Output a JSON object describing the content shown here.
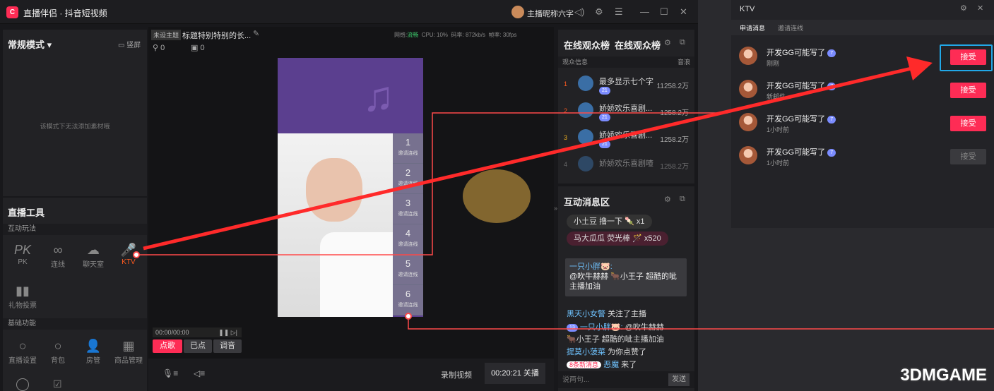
{
  "app": {
    "logo": "C",
    "title": "直播伴侣 · 抖音短视频",
    "streamer": "主播昵称六字"
  },
  "left": {
    "mode": "常规模式",
    "portrait": "竖屏",
    "empty": "该模式下无法添加素材哦",
    "tools_title": "直播工具",
    "sect_interact": "互动玩法",
    "sect_basic": "基础功能",
    "interact": [
      {
        "label": "PK",
        "icon": "PK"
      },
      {
        "label": "连线",
        "icon": "∞"
      },
      {
        "label": "聊天室",
        "icon": "☁"
      },
      {
        "label": "KTV",
        "icon": "🎤"
      }
    ],
    "vote": "礼物投票",
    "basic": [
      {
        "label": "直播设置",
        "icon": "○"
      },
      {
        "label": "背包",
        "icon": "○"
      },
      {
        "label": "房管",
        "icon": "👤"
      },
      {
        "label": "商品管理",
        "icon": "▦"
      }
    ]
  },
  "center": {
    "tag": "未设主题",
    "title": "标题特别特别的长...",
    "viewers": "0",
    "gifts": "0",
    "stats": {
      "net_label": "网络:",
      "net": "流畅",
      "cpu": "CPU: 10%",
      "bitrate": "码率: 872kb/s",
      "fps": "帧率: 30fps"
    },
    "slots": [
      {
        "n": "1",
        "t": "邀请连线"
      },
      {
        "n": "2",
        "t": "邀请连线"
      },
      {
        "n": "3",
        "t": "邀请连线"
      },
      {
        "n": "4",
        "t": "邀请连线"
      },
      {
        "n": "5",
        "t": "邀请连线"
      },
      {
        "n": "6",
        "t": "邀请连线"
      }
    ],
    "time": "00:00/00:00",
    "btn_sing": "点歌",
    "btn_done": "已点",
    "btn_tune": "调音",
    "record": "录制视频",
    "live_time": "00:20:21 关播"
  },
  "ranking": {
    "title1": "在线观众榜",
    "title2": "在线观众榜",
    "col1": "观众信息",
    "col2": "音浪",
    "rows": [
      {
        "rank": "1",
        "name": "最多显示七个字",
        "value": "11258.2万",
        "badge": "21"
      },
      {
        "rank": "2",
        "name": "娇娇欢乐喜剧...",
        "value": "1258.2万",
        "badge": "21"
      },
      {
        "rank": "3",
        "name": "娇娇欢乐喜剧...",
        "value": "1258.2万",
        "badge": "21"
      },
      {
        "rank": "4",
        "name": "娇娇欢乐喜剧喳",
        "value": "1258.2万",
        "badge": ""
      }
    ]
  },
  "chat": {
    "title": "互动消息区",
    "gift1_user": "小土豆",
    "gift1_text": "撸一下",
    "gift1_count": "x1",
    "gift2_user": "马大瓜瓜",
    "gift2_text": "荧光棒",
    "gift2_count": "x520",
    "card_user": "一只小胖🐷:",
    "card_text": "@吹牛赫赫 🐂小王子 超酷的呲主播加油",
    "lines": [
      {
        "user": "黑天小女警",
        "text": "关注了主播"
      },
      {
        "user": "一只小胖🐷:",
        "text": "@吹牛赫赫"
      },
      {
        "user": "",
        "text": "🐂小王子 超酷的呲主播加油"
      },
      {
        "user": "提莫小菠菜",
        "text": "为你点赞了"
      },
      {
        "user": "恶魔",
        "text": "来了"
      }
    ],
    "new_msgs": "8条新消息",
    "input_placeholder": "说两句...",
    "send": "发送"
  },
  "ktv": {
    "title": "KTV",
    "tab1": "申请消息",
    "tab2": "邀请连线",
    "requests": [
      {
        "name": "开发GG可能写了",
        "time": "刚刚",
        "badge": "7",
        "accept": "接受",
        "enabled": true
      },
      {
        "name": "开发GG可能写了",
        "time": "新邮件...",
        "badge": "7",
        "accept": "接受",
        "enabled": true
      },
      {
        "name": "开发GG可能写了",
        "time": "1小时前",
        "badge": "7",
        "accept": "接受",
        "enabled": true
      },
      {
        "name": "开发GG可能写了",
        "time": "1小时前",
        "badge": "7",
        "accept": "接受",
        "enabled": false
      }
    ]
  },
  "watermark": "3DMGAME",
  "colors": {
    "accent": "#fe2c55",
    "arrow": "#ff2a2a",
    "highlight": "#21a8e8",
    "ktv_orange": "#ff5a1f"
  }
}
